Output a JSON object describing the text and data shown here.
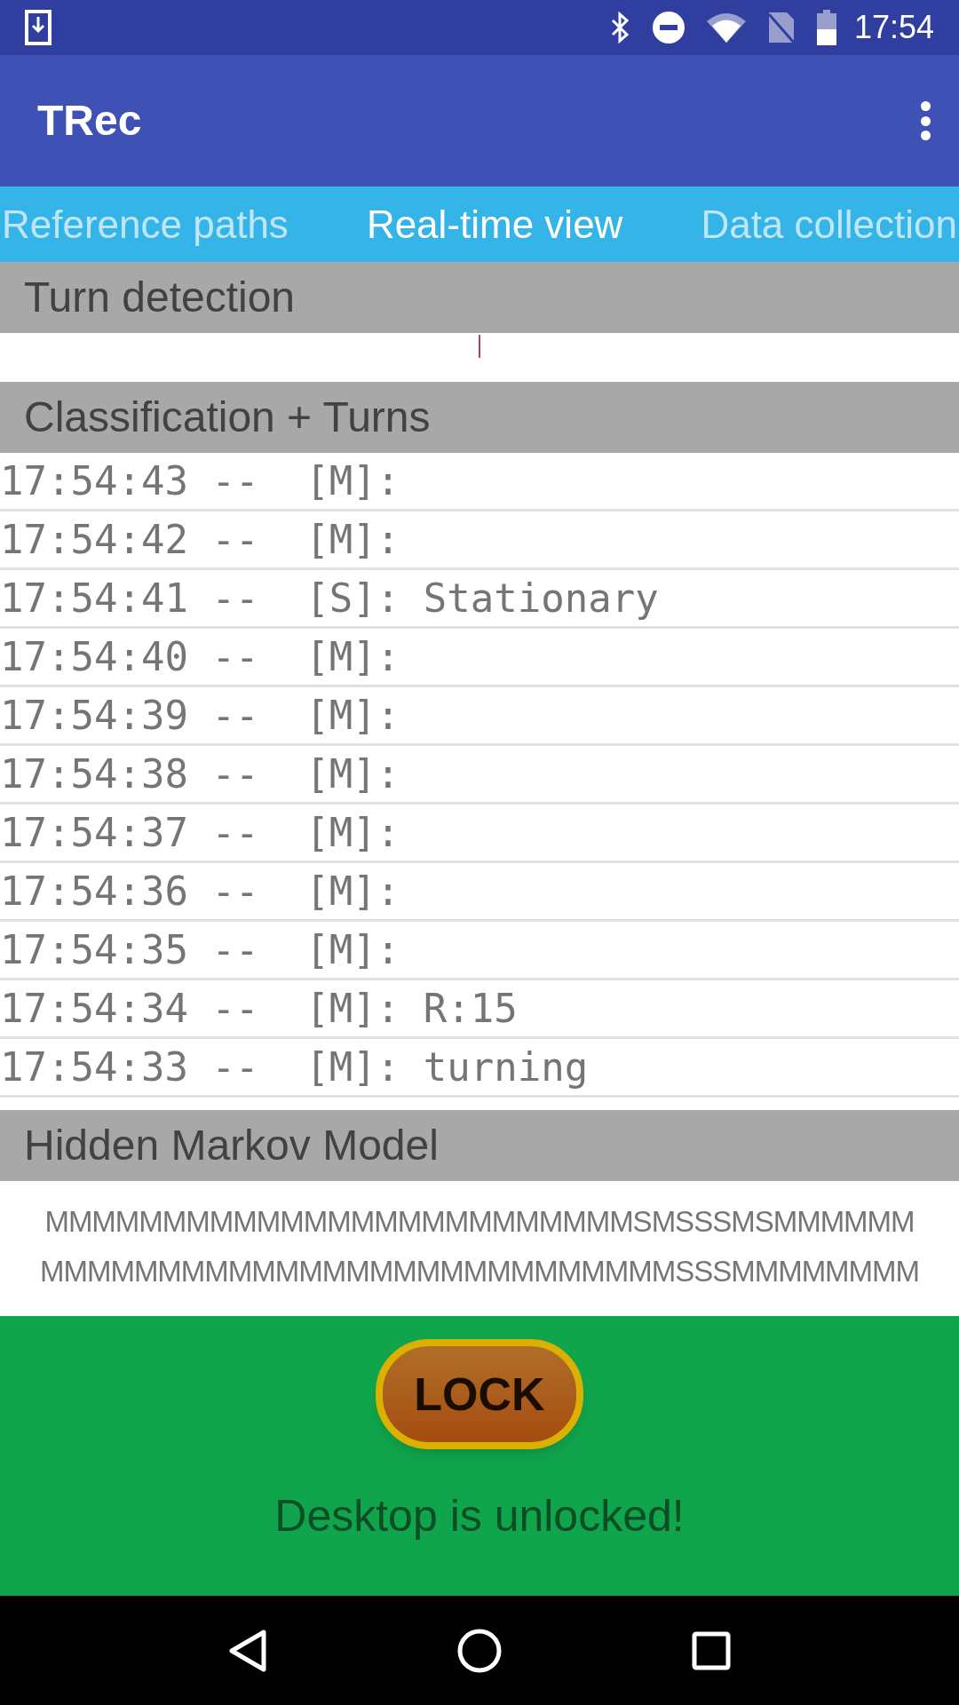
{
  "status_bar": {
    "time": "17:54"
  },
  "app_bar": {
    "title": "TRec"
  },
  "tabs": [
    {
      "label": "Reference paths",
      "selected": false
    },
    {
      "label": "Real-time view",
      "selected": true
    },
    {
      "label": "Data collection",
      "selected": false
    }
  ],
  "turn_detection": {
    "title": "Turn detection"
  },
  "classification": {
    "title": "Classification + Turns",
    "rows": [
      {
        "text": "17:54:43 --  [M]:"
      },
      {
        "text": "17:54:42 --  [M]:"
      },
      {
        "text": "17:54:41 --  [S]: Stationary"
      },
      {
        "text": "17:54:40 --  [M]:"
      },
      {
        "text": "17:54:39 --  [M]:"
      },
      {
        "text": "17:54:38 --  [M]:"
      },
      {
        "text": "17:54:37 --  [M]:"
      },
      {
        "text": "17:54:36 --  [M]:"
      },
      {
        "text": "17:54:35 --  [M]:"
      },
      {
        "text": "17:54:34 --  [M]: R:15"
      },
      {
        "text": "17:54:33 --  [M]: turning"
      }
    ]
  },
  "hmm": {
    "title": "Hidden Markov Model",
    "lines": [
      "MMMMMMMMMMMMMMMMMMMMMMMMMSMSSSMSMMMMMM",
      "MMMMMMMMMMMMMMMMMMMMMMMMMMMSSSMMMMMMMM"
    ]
  },
  "lock_panel": {
    "button": "LOCK",
    "message": "Desktop is unlocked!"
  }
}
